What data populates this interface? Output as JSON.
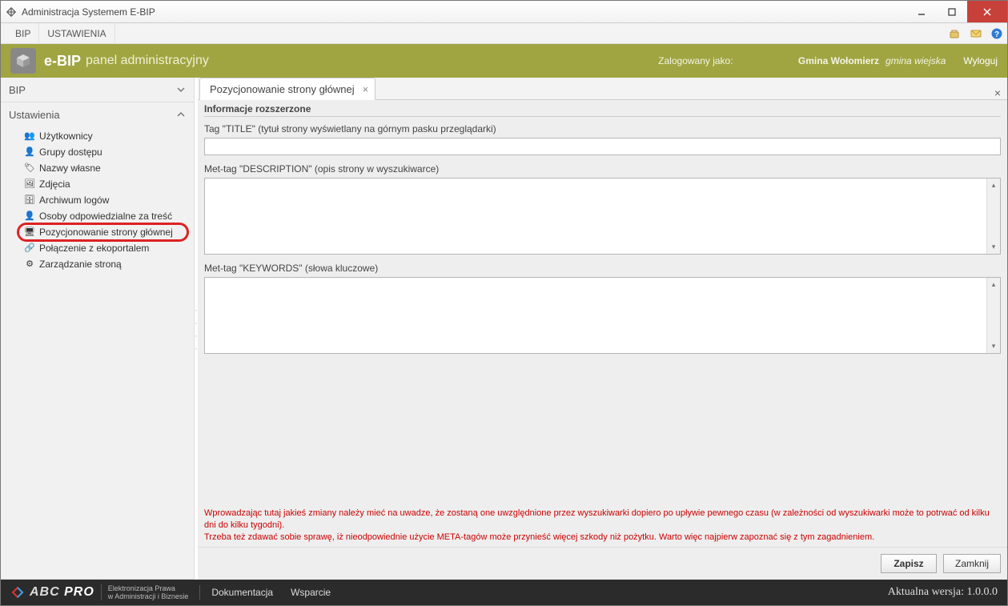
{
  "window": {
    "title": "Administracja Systemem E-BIP"
  },
  "menu": {
    "bip": "BIP",
    "settings": "USTAWIENIA"
  },
  "header": {
    "brand": "e-BIP",
    "subtitle": "panel administracyjny",
    "logged_as_label": "Zalogowany jako:",
    "logged_as_value": "                ",
    "entity": "Gmina Wołomierz",
    "entity_sub": "gmina wiejska",
    "logout": "Wyloguj"
  },
  "sidebar": {
    "section_bip": "BIP",
    "section_settings": "Ustawienia",
    "items": [
      {
        "label": "Użytkownicy"
      },
      {
        "label": "Grupy dostępu"
      },
      {
        "label": "Nazwy własne"
      },
      {
        "label": "Zdjęcia"
      },
      {
        "label": "Archiwum logów"
      },
      {
        "label": "Osoby odpowiedzialne za treść"
      },
      {
        "label": "Pozycjonowanie strony głównej"
      },
      {
        "label": "Połączenie z ekoportalem"
      },
      {
        "label": "Zarządzanie stroną"
      }
    ]
  },
  "tab": {
    "title": "Pozycjonowanie strony głównej"
  },
  "form": {
    "group_title": "Informacje rozszerzone",
    "title_label": "Tag \"TITLE\" (tytuł strony wyświetlany na górnym pasku przeglądarki)",
    "title_value": "",
    "desc_label": "Met-tag \"DESCRIPTION\" (opis strony w wyszukiwarce)",
    "desc_value": "",
    "keywords_label": "Met-tag \"KEYWORDS\" (słowa kluczowe)",
    "keywords_value": "",
    "warning_line1": "Wprowadzając tutaj jakieś zmiany należy mieć na uwadze, że zostaną one uwzględnione przez wyszukiwarki dopiero po upływie pewnego czasu (w zależności od wyszukiwarki może to potrwać od kilku dni do kilku tygodni).",
    "warning_line2": "Trzeba też zdawać sobie sprawę, iż nieodpowiednie użycie META-tagów może przynieść więcej szkody niż pożytku. Warto więc najpierw zapoznać się z tym zagadnieniem.",
    "save": "Zapisz",
    "close": "Zamknij"
  },
  "footer": {
    "brand_a": "ABC",
    "brand_b": " PRO",
    "tag1": "Elektronizacja Prawa",
    "tag2": "w Administracji i Biznesie",
    "doc": "Dokumentacja",
    "support": "Wsparcie",
    "ver_label": "Aktualna wersja: ",
    "ver": "1.0.0.0"
  }
}
